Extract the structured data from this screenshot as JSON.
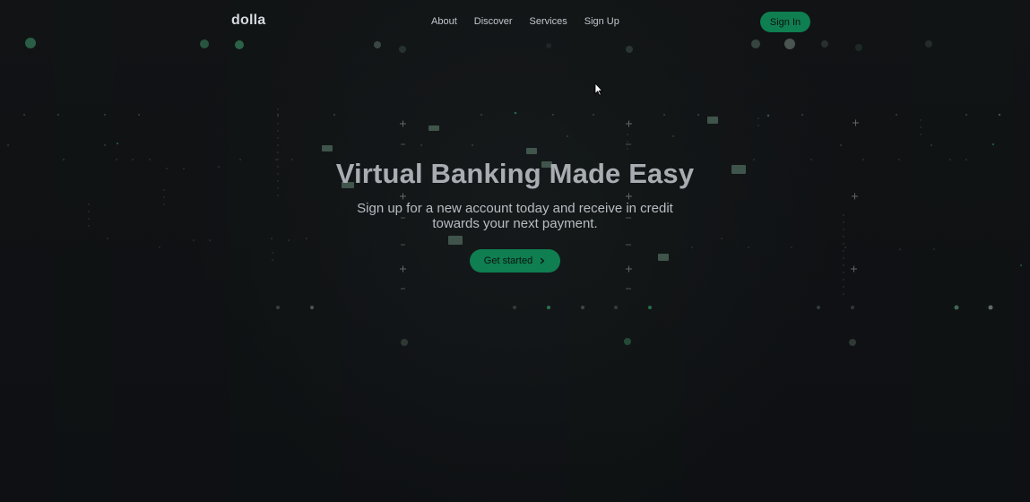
{
  "brand": {
    "logo_text": "dolla"
  },
  "nav": {
    "links": [
      {
        "label": "About"
      },
      {
        "label": "Discover"
      },
      {
        "label": "Services"
      },
      {
        "label": "Sign Up"
      }
    ],
    "signin_label": "Sign In"
  },
  "hero": {
    "title": "Virtual Banking Made Easy",
    "subtitle_line1": "Sign up for a new account today and receive in credit",
    "subtitle_line2": "towards your next payment.",
    "cta_label": "Get started",
    "cta_icon": "chevron-right-icon"
  },
  "theme": {
    "background": "#0f1114",
    "accent_green": "#0f7e50",
    "title_color": "#a9adb2",
    "text_color": "#b8bdc2"
  }
}
